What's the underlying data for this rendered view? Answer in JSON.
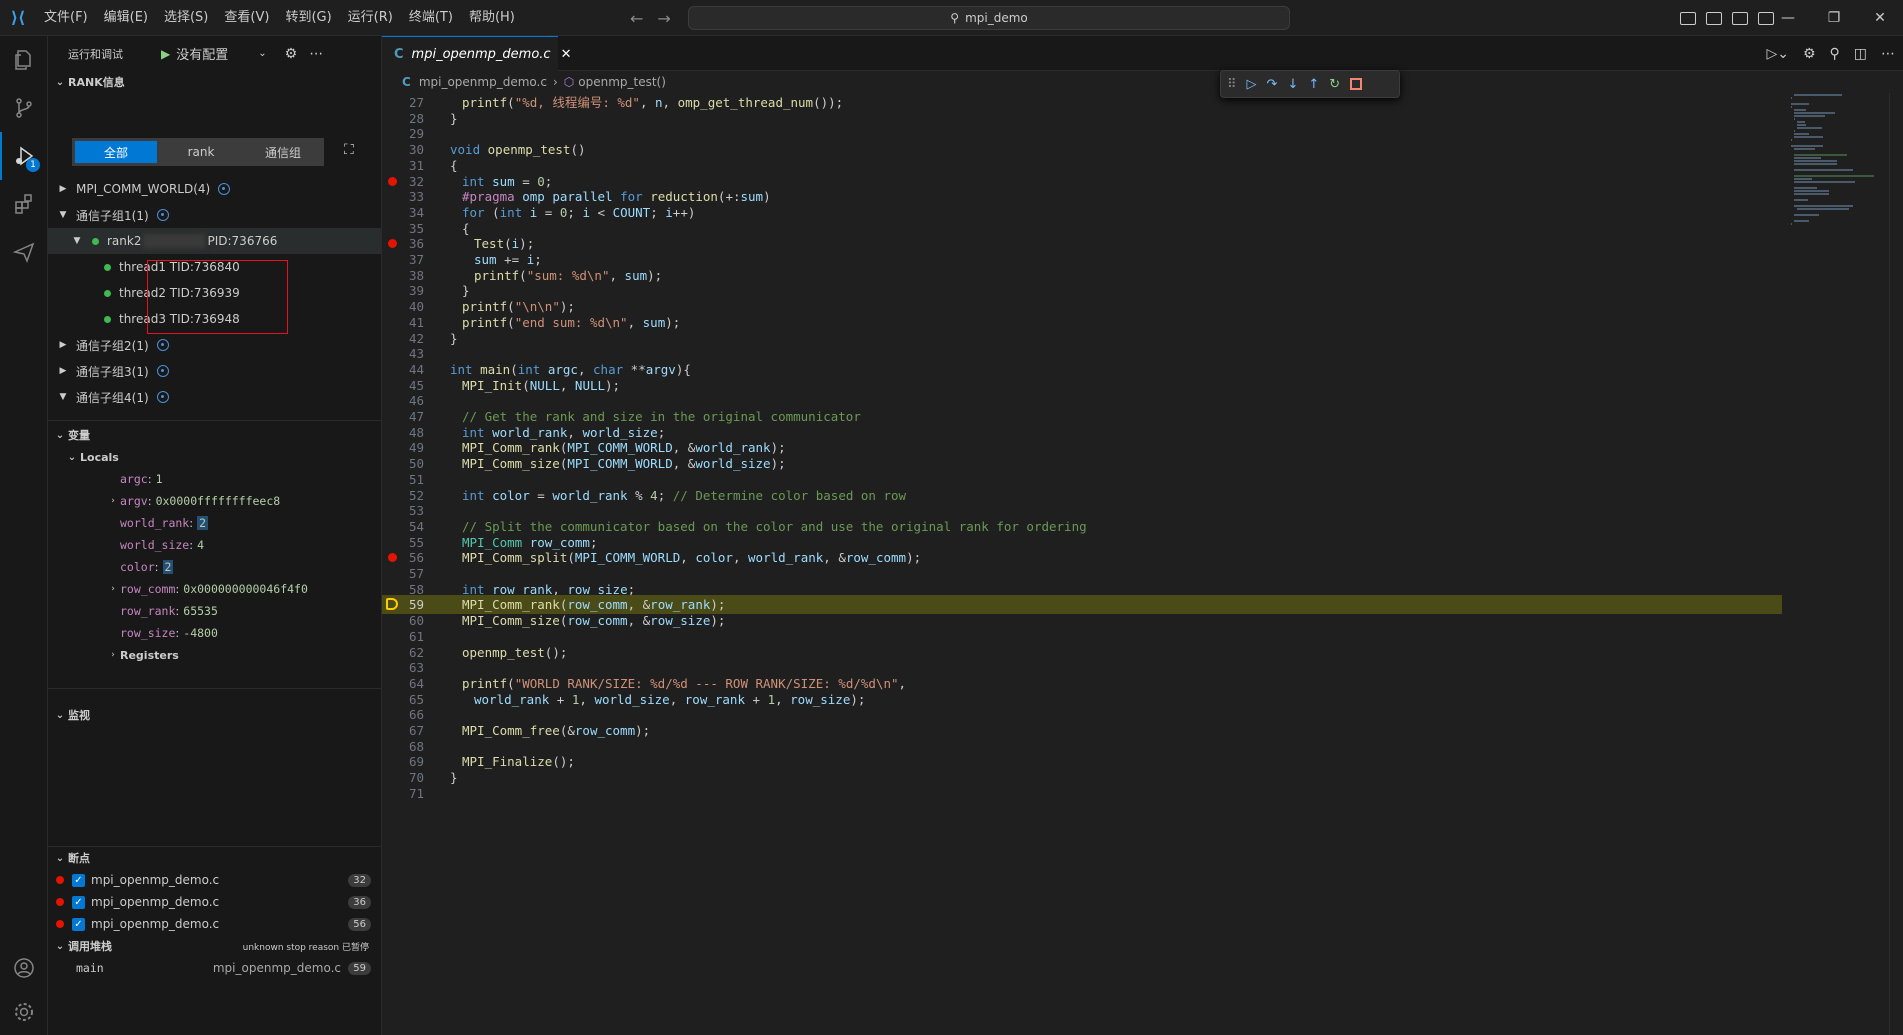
{
  "titlebar": {
    "menu": [
      "文件(F)",
      "编辑(E)",
      "选择(S)",
      "查看(V)",
      "转到(G)",
      "运行(R)",
      "终端(T)",
      "帮助(H)"
    ],
    "search": "mpi_demo"
  },
  "sidebar": {
    "header": {
      "title": "运行和调试",
      "config": "没有配置"
    },
    "rank_section": {
      "title": "RANK信息",
      "segments": [
        "全部",
        "rank",
        "通信组"
      ],
      "selected_segment": "全部",
      "tree": [
        {
          "label": "MPI_COMM_WORLD(4)",
          "expanded": false
        },
        {
          "label": "通信子组1(1)",
          "expanded": true
        },
        {
          "label_a": "rank2",
          "label_b": "PID:736766"
        },
        {
          "label": "thread1 TID:736840"
        },
        {
          "label": "thread2 TID:736939"
        },
        {
          "label": "thread3 TID:736948"
        },
        {
          "label": "通信子组2(1)",
          "expanded": false
        },
        {
          "label": "通信子组3(1)",
          "expanded": false
        },
        {
          "label": "通信子组4(1)",
          "expanded": true
        }
      ]
    },
    "variables": {
      "title": "变量",
      "locals_title": "Locals",
      "items": [
        {
          "name": "argc",
          "value": "1"
        },
        {
          "name": "argv",
          "value": "0x0000ffffffffeec8"
        },
        {
          "name": "world_rank",
          "value": "2"
        },
        {
          "name": "world_size",
          "value": "4"
        },
        {
          "name": "color",
          "value": "2"
        },
        {
          "name": "row_comm",
          "value": "0x000000000046f4f0"
        },
        {
          "name": "row_rank",
          "value": "65535"
        },
        {
          "name": "row_size",
          "value": "-4800"
        }
      ],
      "registers": "Registers"
    },
    "watch": {
      "title": "监视"
    },
    "breakpoints": {
      "title": "断点",
      "items": [
        {
          "file": "mpi_openmp_demo.c",
          "line": "32"
        },
        {
          "file": "mpi_openmp_demo.c",
          "line": "36"
        },
        {
          "file": "mpi_openmp_demo.c",
          "line": "56"
        }
      ]
    },
    "callstack": {
      "title": "调用堆栈",
      "status": "unknown stop reason 已暂停",
      "frame": "main",
      "frame_file": "mpi_openmp_demo.c",
      "frame_line": "59"
    }
  },
  "editor": {
    "tab": "mpi_openmp_demo.c",
    "breadcrumb_file": "mpi_openmp_demo.c",
    "breadcrumb_symbol": "openmp_test()",
    "current_line": 59,
    "breakpoint_lines": [
      32,
      36,
      56
    ],
    "lines": [
      {
        "n": "27",
        "t": "printf(\"%d, 线程编号: %d\", n, omp_get_thread_num());"
      },
      {
        "n": "28",
        "t": "}"
      },
      {
        "n": "29",
        "t": ""
      },
      {
        "n": "30",
        "t": "void openmp_test()"
      },
      {
        "n": "31",
        "t": "{"
      },
      {
        "n": "32",
        "t": "int sum = 0;"
      },
      {
        "n": "33",
        "t": "#pragma omp parallel for reduction(+:sum)"
      },
      {
        "n": "34",
        "t": "for (int i = 0; i < COUNT; i++)"
      },
      {
        "n": "35",
        "t": "{"
      },
      {
        "n": "36",
        "t": "Test(i);"
      },
      {
        "n": "37",
        "t": "sum += i;"
      },
      {
        "n": "38",
        "t": "printf(\"sum: %d\\n\", sum);"
      },
      {
        "n": "39",
        "t": "}"
      },
      {
        "n": "40",
        "t": "printf(\"\\n\\n\");"
      },
      {
        "n": "41",
        "t": "printf(\"end sum: %d\\n\", sum);"
      },
      {
        "n": "42",
        "t": "}"
      },
      {
        "n": "43",
        "t": ""
      },
      {
        "n": "44",
        "t": "int main(int argc, char **argv){"
      },
      {
        "n": "45",
        "t": "MPI_Init(NULL, NULL);"
      },
      {
        "n": "46",
        "t": ""
      },
      {
        "n": "47",
        "t": "// Get the rank and size in the original communicator"
      },
      {
        "n": "48",
        "t": "int world_rank, world_size;"
      },
      {
        "n": "49",
        "t": "MPI_Comm_rank(MPI_COMM_WORLD, &world_rank);"
      },
      {
        "n": "50",
        "t": "MPI_Comm_size(MPI_COMM_WORLD, &world_size);"
      },
      {
        "n": "51",
        "t": ""
      },
      {
        "n": "52",
        "t": "int color = world_rank % 4; // Determine color based on row"
      },
      {
        "n": "53",
        "t": ""
      },
      {
        "n": "54",
        "t": "// Split the communicator based on the color and use the original rank for ordering"
      },
      {
        "n": "55",
        "t": "MPI_Comm row_comm;"
      },
      {
        "n": "56",
        "t": "MPI_Comm_split(MPI_COMM_WORLD, color, world_rank, &row_comm);"
      },
      {
        "n": "57",
        "t": ""
      },
      {
        "n": "58",
        "t": "int row_rank, row_size;"
      },
      {
        "n": "59",
        "t": "MPI_Comm_rank(row_comm, &row_rank);"
      },
      {
        "n": "60",
        "t": "MPI_Comm_size(row_comm, &row_size);"
      },
      {
        "n": "61",
        "t": ""
      },
      {
        "n": "62",
        "t": "openmp_test();"
      },
      {
        "n": "63",
        "t": ""
      },
      {
        "n": "64",
        "t": "printf(\"WORLD RANK/SIZE: %d/%d --- ROW RANK/SIZE: %d/%d\\n\","
      },
      {
        "n": "65",
        "t": "world_rank + 1, world_size, row_rank + 1, row_size);"
      },
      {
        "n": "66",
        "t": ""
      },
      {
        "n": "67",
        "t": "MPI_Comm_free(&row_comm);"
      },
      {
        "n": "68",
        "t": ""
      },
      {
        "n": "69",
        "t": "MPI_Finalize();"
      },
      {
        "n": "70",
        "t": "}"
      },
      {
        "n": "71",
        "t": ""
      }
    ]
  }
}
